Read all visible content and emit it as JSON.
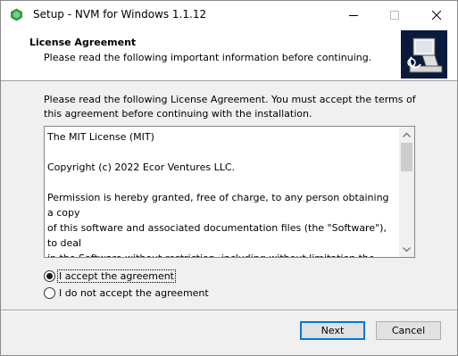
{
  "window": {
    "title": "Setup - NVM for Windows 1.1.12",
    "controls": {
      "minimize_icon": "minimize-icon",
      "maximize_icon": "maximize-icon",
      "close_icon": "close-icon"
    }
  },
  "header": {
    "title": "License Agreement",
    "subtitle": "Please read the following important information before continuing."
  },
  "main": {
    "intro": "Please read the following License Agreement. You must accept the terms of this agreement before continuing with the installation.",
    "license_paragraphs": [
      "The MIT License (MIT)",
      "Copyright (c) 2022 Ecor Ventures LLC.",
      "Permission is hereby granted, free of charge, to any person obtaining a copy\nof this software and associated documentation files (the \"Software\"), to deal\nin the Software without restriction, including without limitation the rights\nto use, copy, modify, merge, publish, distribute, sublicense, and/or sell\ncopies of the Software, and to permit persons to whom the Software is"
    ]
  },
  "options": {
    "accept_label": "I accept the agreement",
    "decline_label": "I do not accept the agreement",
    "selected": "accept"
  },
  "buttons": {
    "next_label": "Next",
    "cancel_label": "Cancel"
  },
  "colors": {
    "accent": "#0078d7",
    "app_icon_green": "#2f9e44",
    "background": "#f0f0f0"
  }
}
